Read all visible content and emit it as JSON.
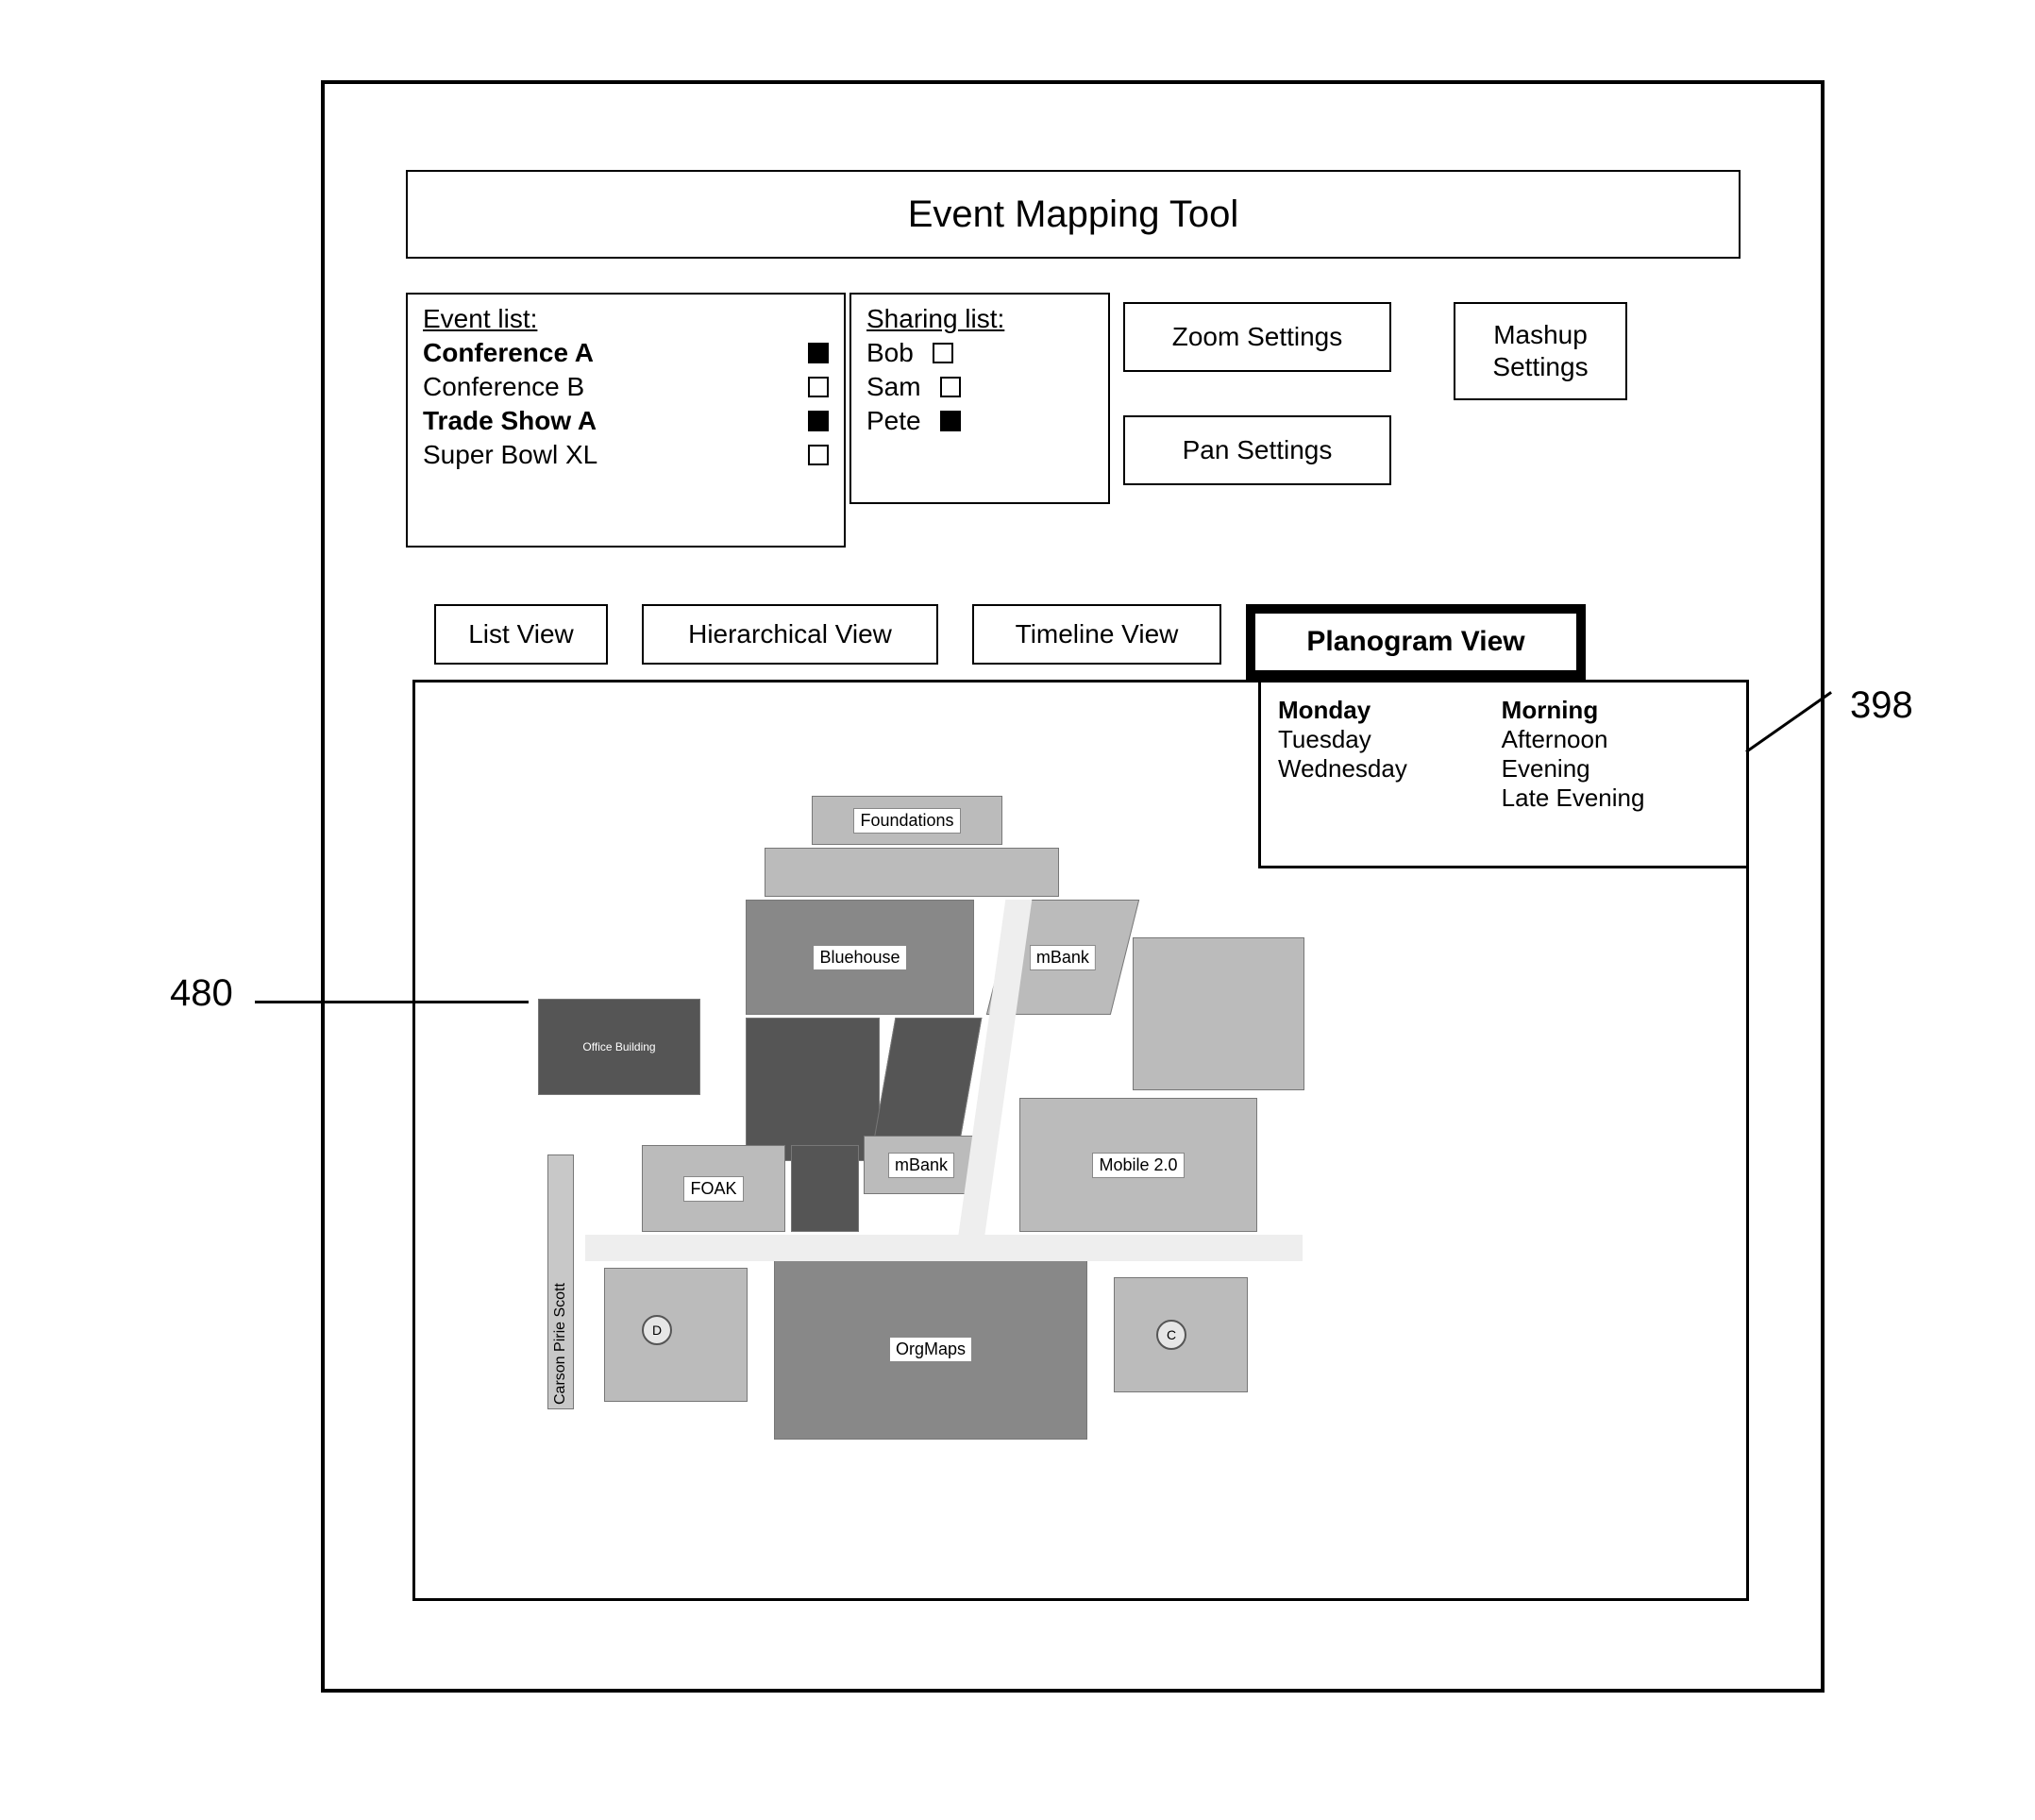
{
  "title": "Event Mapping Tool",
  "event_list": {
    "heading": "Event list:",
    "items": [
      {
        "label": "Conference A",
        "checked": true,
        "bold": true
      },
      {
        "label": "Conference B",
        "checked": false,
        "bold": false
      },
      {
        "label": "Trade Show A",
        "checked": true,
        "bold": true
      },
      {
        "label": "Super Bowl XL",
        "checked": false,
        "bold": false
      }
    ]
  },
  "sharing_list": {
    "heading": "Sharing list:",
    "items": [
      {
        "label": "Bob",
        "checked": false
      },
      {
        "label": "Sam",
        "checked": false
      },
      {
        "label": "Pete",
        "checked": true
      }
    ]
  },
  "buttons": {
    "zoom": "Zoom Settings",
    "pan": "Pan Settings",
    "mashup": "Mashup Settings"
  },
  "tabs": {
    "list": "List View",
    "hier": "Hierarchical View",
    "time": "Timeline View",
    "plan": "Planogram View",
    "active": "plan"
  },
  "day_filter": {
    "days": [
      {
        "label": "Monday",
        "bold": true
      },
      {
        "label": "Tuesday",
        "bold": false
      },
      {
        "label": "Wednesday",
        "bold": false
      }
    ],
    "times": [
      {
        "label": "Morning",
        "bold": true
      },
      {
        "label": "Afternoon",
        "bold": false
      },
      {
        "label": "Evening",
        "bold": false
      },
      {
        "label": "Late Evening",
        "bold": false
      }
    ]
  },
  "planogram": {
    "rooms": {
      "foundations": "Foundations",
      "bluehouse": "Bluehouse",
      "mbank1": "mBank",
      "mbank2": "mBank",
      "foak": "FOAK",
      "mobile20": "Mobile 2.0",
      "orgmaps": "OrgMaps",
      "carson": "Carson Pirie Scott",
      "office": "Office Building",
      "marker_c": "C",
      "marker_d": "D"
    }
  },
  "callouts": {
    "left": "480",
    "right": "398"
  }
}
